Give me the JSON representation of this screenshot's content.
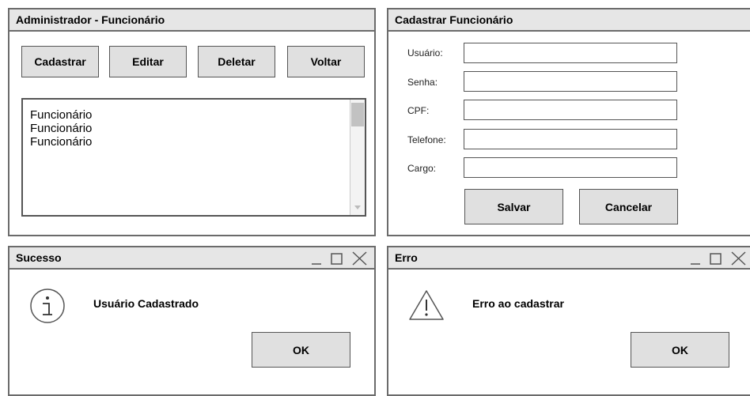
{
  "admin": {
    "title": "Administrador - Funcionário",
    "buttons": {
      "cadastrar": "Cadastrar",
      "editar": "Editar",
      "deletar": "Deletar",
      "voltar": "Voltar"
    },
    "list": [
      "Funcionário",
      "Funcionário",
      "Funcionário"
    ]
  },
  "form": {
    "title": "Cadastrar Funcionário",
    "fields": [
      {
        "label": "Usuário:",
        "value": ""
      },
      {
        "label": "Senha:",
        "value": ""
      },
      {
        "label": "CPF:",
        "value": ""
      },
      {
        "label": "Telefone:",
        "value": ""
      },
      {
        "label": "Cargo:",
        "value": ""
      }
    ],
    "save_label": "Salvar",
    "cancel_label": "Cancelar"
  },
  "success": {
    "title": "Sucesso",
    "message": "Usuário Cadastrado",
    "ok_label": "OK",
    "icon": "info-icon"
  },
  "error": {
    "title": "Erro",
    "message": "Erro ao cadastrar",
    "ok_label": "OK",
    "icon": "warning-icon"
  },
  "window_controls": {
    "minimize": "_",
    "maximize": "□",
    "close": "✕"
  }
}
